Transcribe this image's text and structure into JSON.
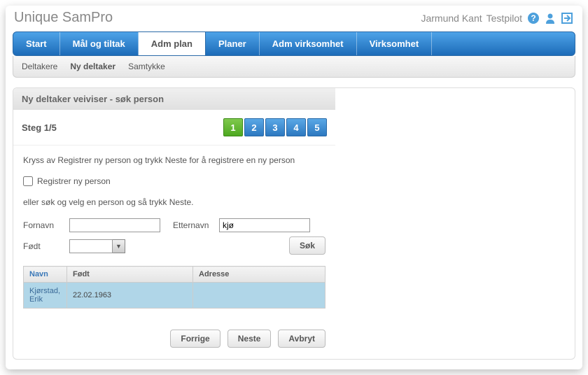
{
  "header": {
    "app_title": "Unique SamPro",
    "user_name": "Jarmund Kant",
    "mode": "Testpilot"
  },
  "main_tabs": [
    {
      "label": "Start"
    },
    {
      "label": "Mål og tiltak"
    },
    {
      "label": "Adm plan",
      "active": true
    },
    {
      "label": "Planer"
    },
    {
      "label": "Adm virksomhet"
    },
    {
      "label": "Virksomhet"
    }
  ],
  "sub_tabs": [
    {
      "label": "Deltakere"
    },
    {
      "label": "Ny deltaker",
      "active": true
    },
    {
      "label": "Samtykke"
    }
  ],
  "wizard": {
    "title": "Ny deltaker veiviser - søk person",
    "step_label": "Steg 1/5",
    "steps": [
      "1",
      "2",
      "3",
      "4",
      "5"
    ],
    "current_step": 1,
    "instruction1": "Kryss av Registrer ny person og trykk Neste for å registrere en ny person",
    "register_checkbox_label": "Registrer ny person",
    "instruction2": "eller søk og velg en person og så trykk Neste.",
    "fornavn_label": "Fornavn",
    "fornavn_value": "",
    "etternavn_label": "Etternavn",
    "etternavn_value": "kjø",
    "fodt_label": "Født",
    "fodt_value": "",
    "search_button": "Søk",
    "table": {
      "cols": [
        "Navn",
        "Født",
        "Adresse"
      ],
      "rows": [
        {
          "navn": "Kjørstad, Erik",
          "fodt": "22.02.1963",
          "adresse": ""
        }
      ]
    },
    "buttons": {
      "prev": "Forrige",
      "next": "Neste",
      "cancel": "Avbryt"
    }
  }
}
